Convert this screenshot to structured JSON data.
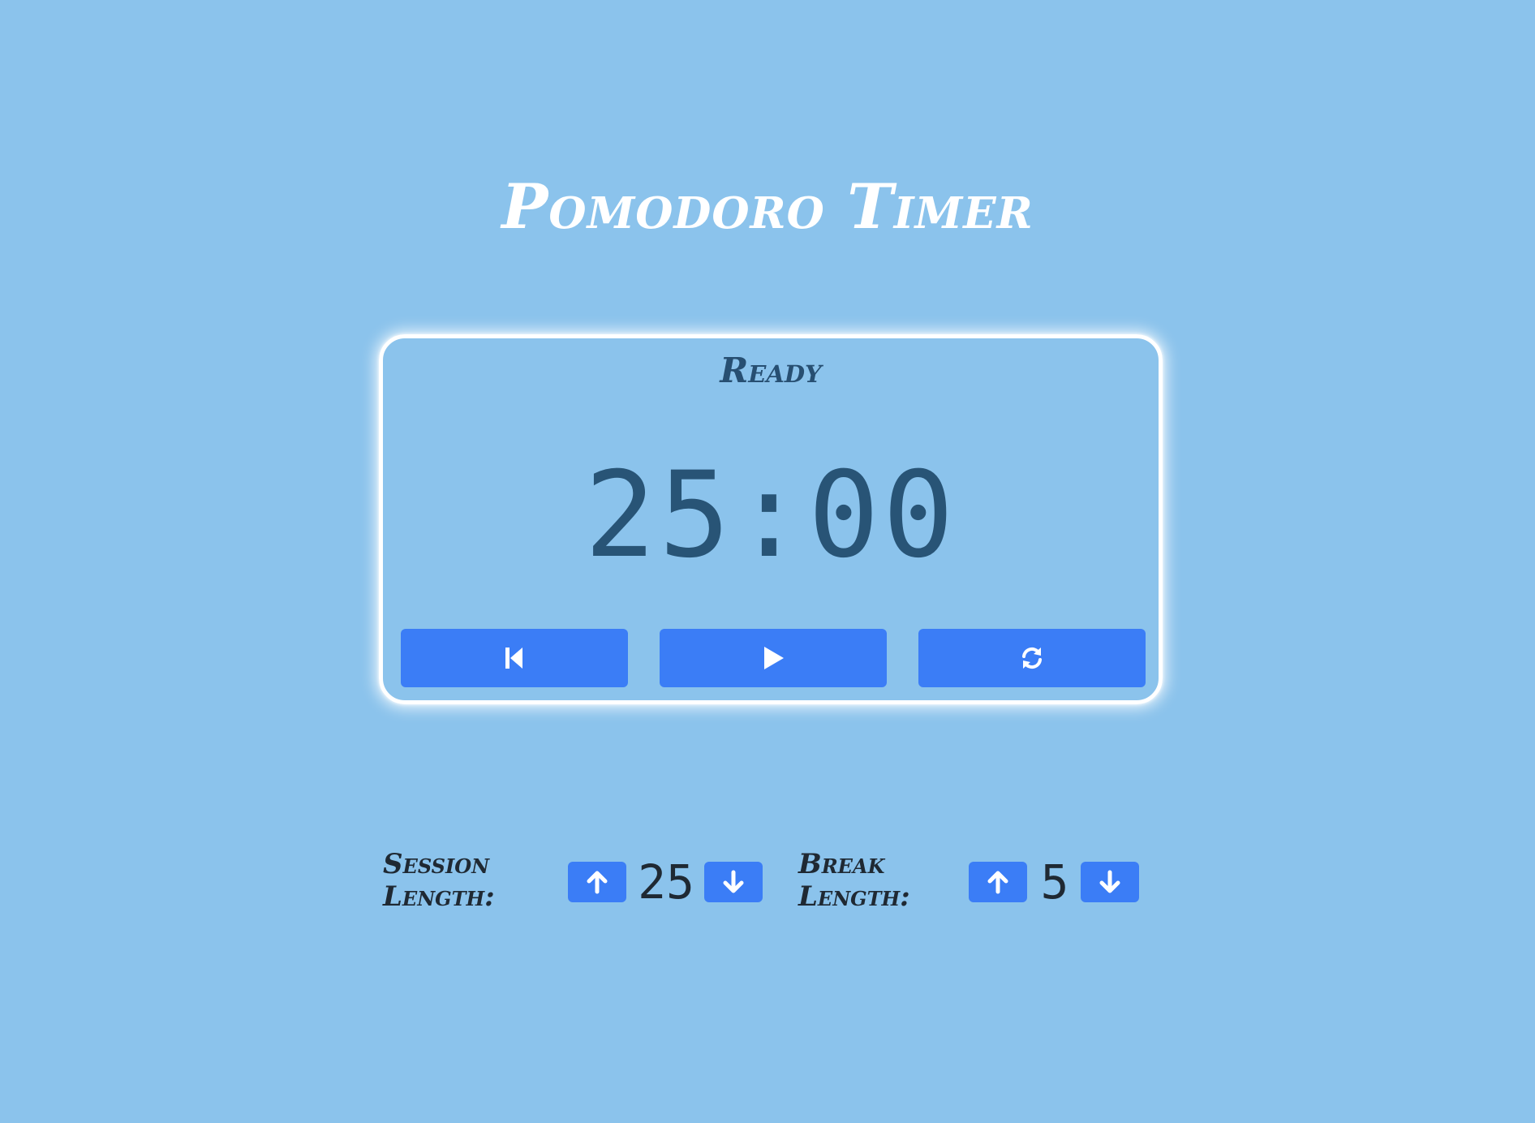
{
  "header": {
    "title": "Pomodoro Timer"
  },
  "timer": {
    "status": "Ready",
    "time": "25:00",
    "controls": [
      {
        "icon": "skip-back-icon"
      },
      {
        "icon": "play-icon"
      },
      {
        "icon": "refresh-icon"
      }
    ]
  },
  "settings": {
    "session": {
      "label": "Session Length:",
      "value": "25",
      "up_icon": "arrow-up-icon",
      "down_icon": "arrow-down-icon"
    },
    "break": {
      "label": "Break Length:",
      "value": "5",
      "up_icon": "arrow-up-icon",
      "down_icon": "arrow-down-icon"
    }
  },
  "colors": {
    "background": "#8bc3ec",
    "accent": "#3b7df6",
    "display_text": "#285476",
    "card_border": "#ffffff",
    "label_text": "#1f2933"
  }
}
